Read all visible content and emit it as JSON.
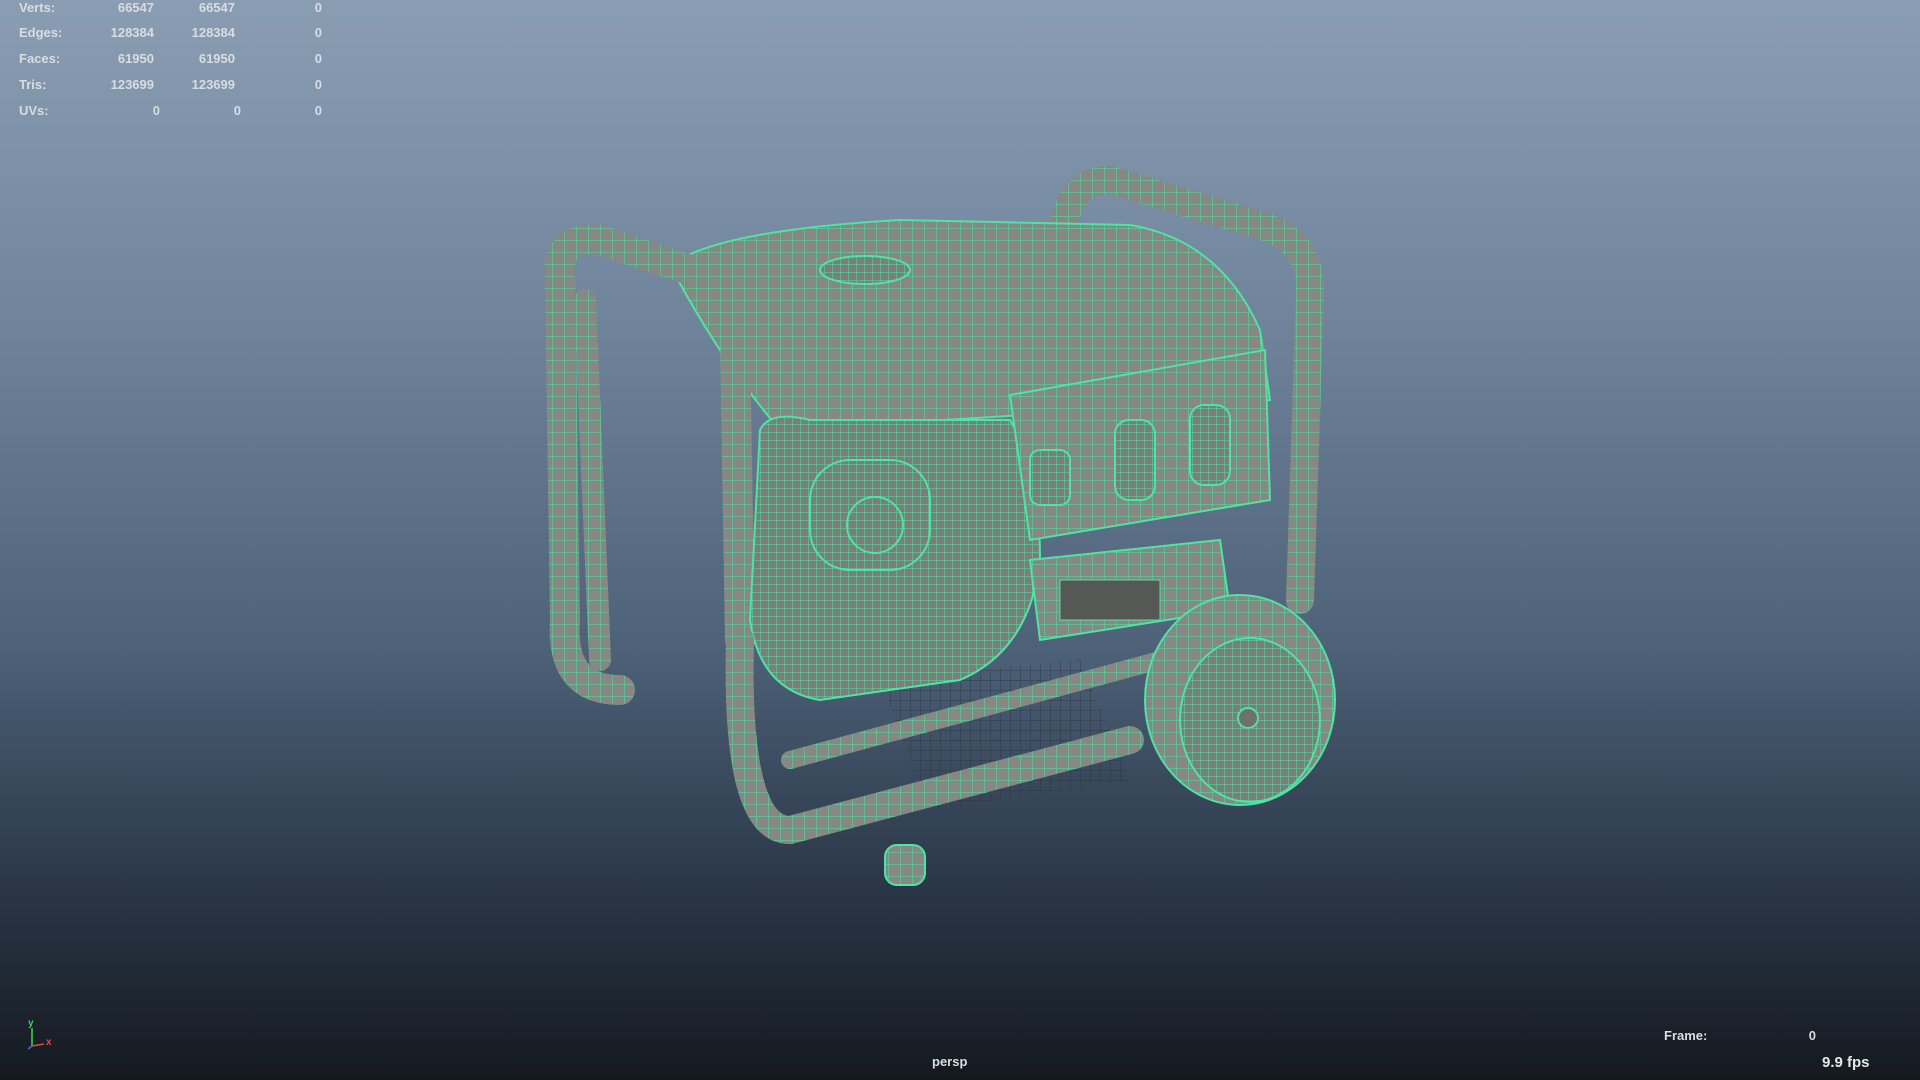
{
  "stats": {
    "rows": [
      {
        "label": "Verts:",
        "v1": "66547",
        "v2": "66547",
        "v3": "0"
      },
      {
        "label": "Edges:",
        "v1": "128384",
        "v2": "128384",
        "v3": "0"
      },
      {
        "label": "Faces:",
        "v1": "61950",
        "v2": "61950",
        "v3": "0"
      },
      {
        "label": "Tris:",
        "v1": "123699",
        "v2": "123699",
        "v3": "0"
      },
      {
        "label": "UVs:",
        "v1": "0",
        "v2": "0",
        "v3": "0"
      }
    ]
  },
  "viewport": {
    "camera": "persp",
    "frame_label": "Frame:",
    "frame_value": "0",
    "fps": "9.9 fps",
    "wire_color": "#4fe3a4",
    "mesh_color": "#8a8a86"
  },
  "axis": {
    "y_label": "y",
    "x_label": "x",
    "y_color": "#3fd45a",
    "x_color": "#e04848",
    "z_color": "#5f5fe0"
  }
}
